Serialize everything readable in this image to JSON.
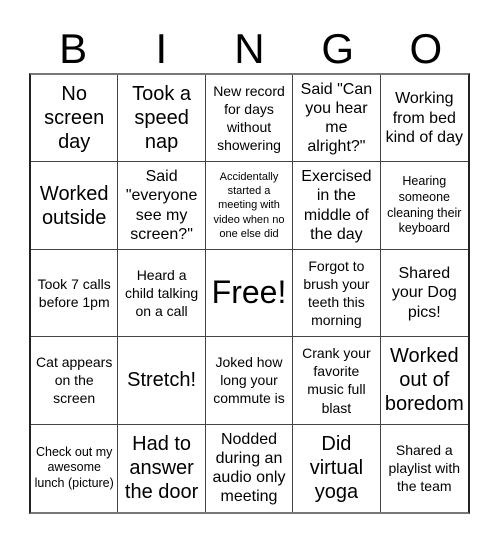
{
  "header": {
    "letters": [
      "B",
      "I",
      "N",
      "G",
      "O"
    ]
  },
  "board": {
    "rows": [
      [
        "No screen day",
        "Took a speed nap",
        "New record for days without showering",
        "Said \"Can you hear me alright?\"",
        "Working from bed kind of day"
      ],
      [
        "Worked outside",
        "Said \"everyone see my screen?\"",
        "Accidentally started a meeting with video when no one else did",
        "Exercised in the middle of the day",
        "Hearing someone cleaning their keyboard"
      ],
      [
        "Took 7 calls before 1pm",
        "Heard a child talking on a call",
        "Free!",
        "Forgot to brush your teeth this morning",
        "Shared your Dog pics!"
      ],
      [
        "Cat appears on the screen",
        "Stretch!",
        "Joked how long your commute is",
        "Crank your favorite music full blast",
        "Worked out of boredom"
      ],
      [
        "Check out my awesome lunch (picture)",
        "Had to answer the door",
        "Nodded during an audio only meeting",
        "Did virtual yoga",
        "Shared a playlist with the team"
      ]
    ]
  }
}
